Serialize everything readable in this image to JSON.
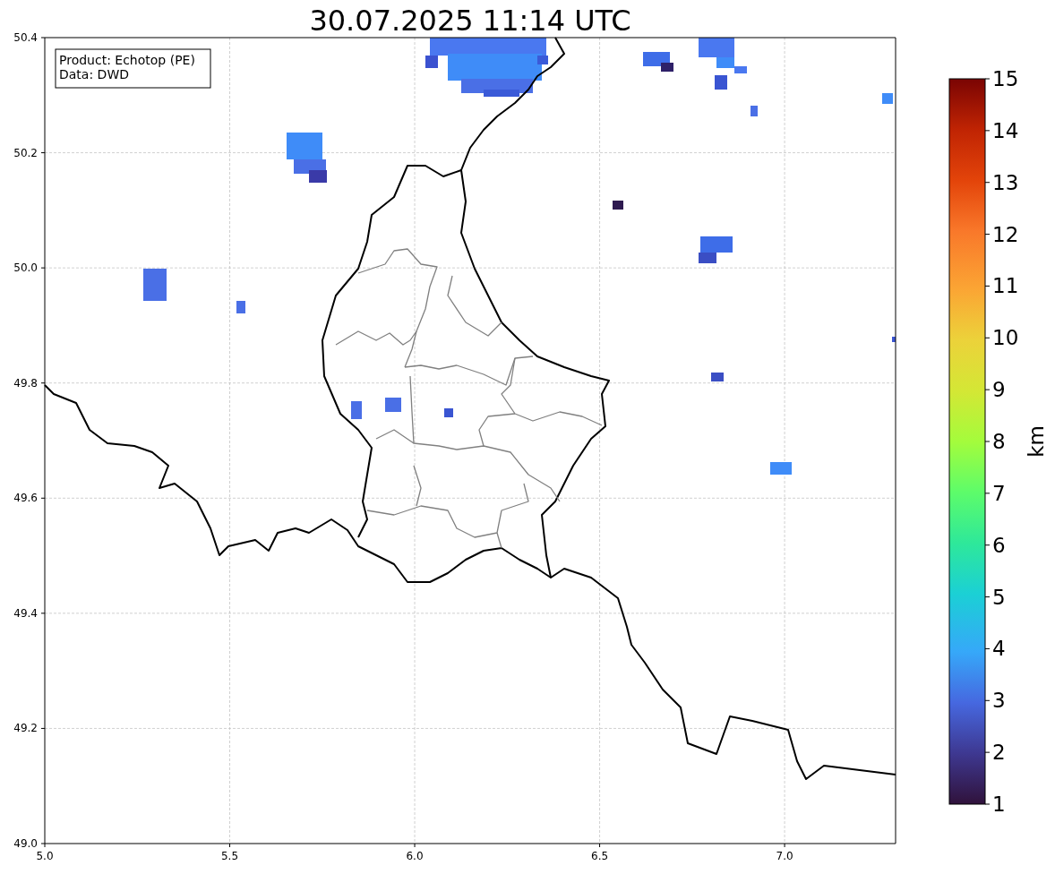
{
  "title": "30.07.2025 11:14 UTC",
  "info_box": [
    "Product: Echotop (PE)",
    "Data: DWD"
  ],
  "x_ticks": [
    "5.0",
    "5.5",
    "6.0",
    "6.5",
    "7.0"
  ],
  "y_ticks": [
    "50.4",
    "50.2",
    "50.0",
    "49.8",
    "49.6",
    "49.4",
    "49.2",
    "49.0"
  ],
  "colorbar": {
    "label": "km",
    "ticks": [
      "15",
      "14",
      "13",
      "12",
      "11",
      "10",
      "9",
      "8",
      "7",
      "6",
      "5",
      "4",
      "3",
      "2",
      "1"
    ]
  }
}
